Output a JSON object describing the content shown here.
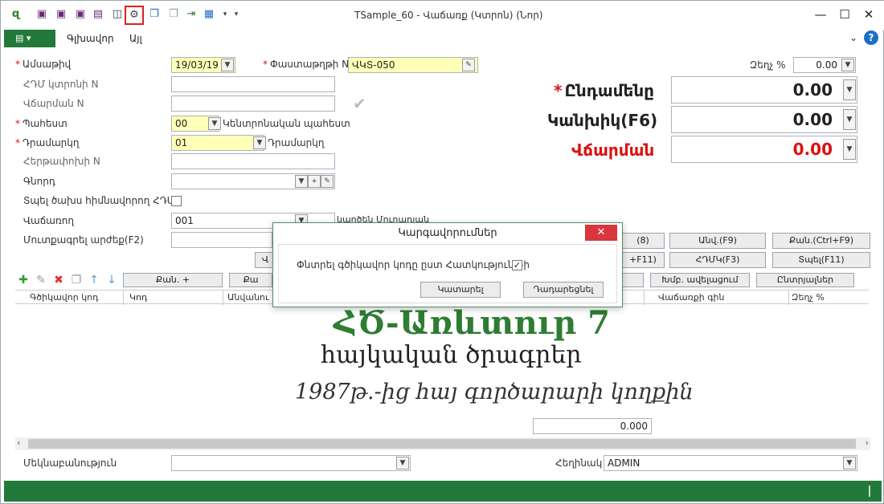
{
  "window": {
    "title": "TSample_60 - Վաճառք (Կտրոն) (Նոր)",
    "minimize": "—",
    "maximize": "☐",
    "close": "✕"
  },
  "toolbar": {
    "icons": [
      "app-icon",
      "save-icon",
      "save-close-icon",
      "save-as-icon",
      "print-icon",
      "preview-icon",
      "settings-doc-icon",
      "copy-icon",
      "paste-icon",
      "export-icon",
      "grid-icon",
      "dropdown-arrow-icon"
    ]
  },
  "menu": {
    "toggle": "▤ ▾",
    "items": [
      "Գլխավոր",
      "Այլ"
    ],
    "chevron": "⌄",
    "help": "?"
  },
  "form": {
    "date_label": "Ամսաթիվ",
    "date_value": "19/03/19",
    "doc_no_label": "Փաստաթղթի N",
    "doc_no_value": "ՎԿՏ-050",
    "hdm_receipt_label": "ՀԴՄ կտրոնի N",
    "payment_no_label": "Վճարման N",
    "warehouse_label": "Պահեստ",
    "warehouse_code": "00",
    "warehouse_name": "Կենտրոնական պահեստ",
    "cashbox_label": "Դրամարկղ",
    "cashbox_code": "01",
    "cashbox_name": "Դրամարկղ",
    "return_no_label": "Հերթափոխի N",
    "buyer_label": "Գնորդ",
    "print_basis_label": "Տպել ծախս հիմնավորող ՀԴՄԿ",
    "seller_label": "Վաճառող",
    "seller_value": "001",
    "seller_extra": "կարծեն Մուրադյան",
    "enter_value_label": "Մուտքագրել արժեք(F2)",
    "discount_label": "Զեղչ %",
    "discount_value": "0.00"
  },
  "totals": {
    "total_label": "Ընդամենը",
    "total_value": "0.00",
    "cash_label": "Կանխիկ(F6)",
    "cash_value": "0.00",
    "payment_label": "Վճարման",
    "payment_value": "0.00"
  },
  "buttons": {
    "f8": "(8)",
    "pay_f9": "Անվ.(F9)",
    "qty_f9": "Քան.(Ctrl+F9)",
    "f11": "+F11)",
    "hdmk_f3": "ՀԴՄԿ(F3)",
    "print_f11": "Տպել(F11)",
    "small_left": "Վ",
    "qty_plus": "Քան. +",
    "qty2": "Քա",
    "group_add": "Խմբ. ավելացում",
    "selections": "Ընտրյալներ"
  },
  "grid": {
    "columns": [
      "Գծիկավոր կոդ",
      "Կոդ",
      "Անվանու",
      "Վաճառքի գին",
      "Զեղչ %"
    ],
    "total": "0.000"
  },
  "watermark": {
    "line1": "ՀԾ-Առևտուր 7",
    "line2": "հայկական ծրագրեր",
    "line3": "1987թ.-ից հայ գործարարի կողքին"
  },
  "footer": {
    "comment_label": "Մեկնաբանություն",
    "author_label": "Հեղինակ",
    "author_value": "ADMIN"
  },
  "dialog": {
    "title": "Կարգավորումներ",
    "option_label": "Փնտրել գծիկավոր կոդը ըստ Հատկություն1-ի",
    "option_checked": "✓",
    "ok": "Կատարել",
    "cancel": "Դադարեցնել"
  },
  "colors": {
    "accent_green": "#227a3a",
    "watermark_green": "#2e7d32",
    "required_red": "#d11111",
    "close_red": "#d9363e",
    "highlight_yellow": "#ffffb8"
  }
}
